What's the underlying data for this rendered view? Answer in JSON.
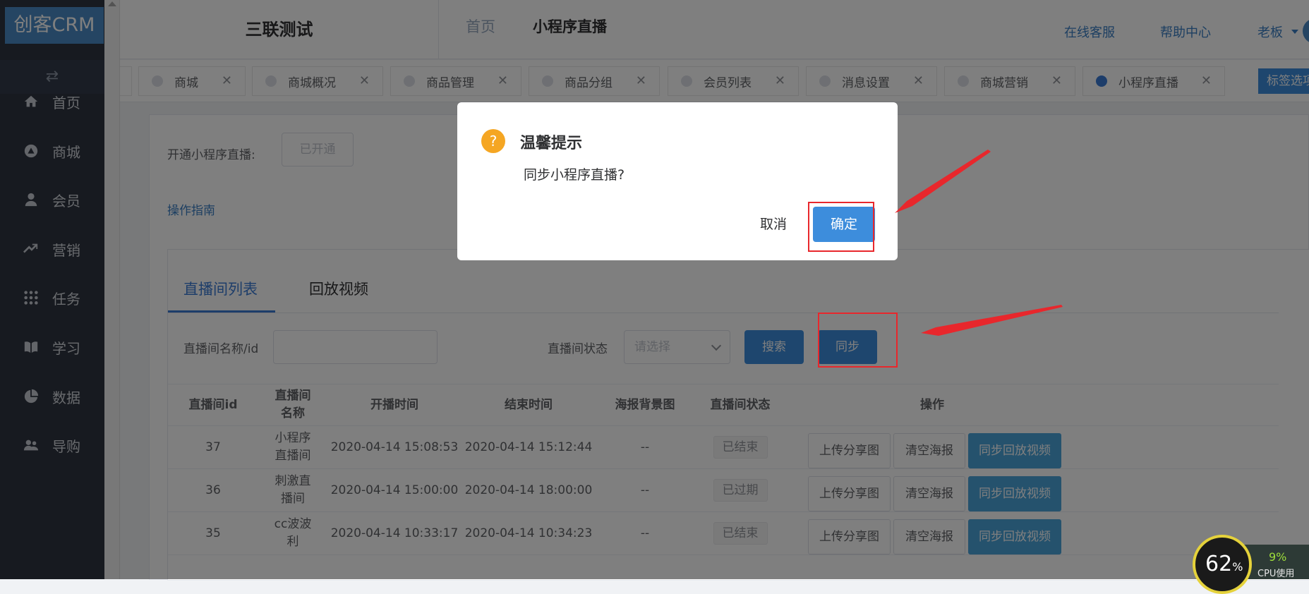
{
  "sidebar": {
    "logo": "创客CRM",
    "collapse_icon": "swap-arrows-icon",
    "items": [
      {
        "label": "首页",
        "icon": "home-icon"
      },
      {
        "label": "商城",
        "icon": "shop-icon"
      },
      {
        "label": "会员",
        "icon": "user-icon"
      },
      {
        "label": "营销",
        "icon": "trend-icon"
      },
      {
        "label": "任务",
        "icon": "grid-icon"
      },
      {
        "label": "学习",
        "icon": "book-icon"
      },
      {
        "label": "数据",
        "icon": "pie-icon"
      },
      {
        "label": "导购",
        "icon": "people-icon"
      }
    ]
  },
  "header": {
    "app_name": "三联测试",
    "breadcrumb_home": "首页",
    "breadcrumb_current": "小程序直播",
    "links": [
      "在线客服",
      "帮助中心"
    ],
    "user": "老板"
  },
  "tabs": {
    "items": [
      {
        "label": "商城",
        "active": false
      },
      {
        "label": "商城概况",
        "active": false
      },
      {
        "label": "商品管理",
        "active": false
      },
      {
        "label": "商品分组",
        "active": false
      },
      {
        "label": "会员列表",
        "active": false
      },
      {
        "label": "消息设置",
        "active": false
      },
      {
        "label": "商城营销",
        "active": false
      },
      {
        "label": "小程序直播",
        "active": true
      }
    ],
    "close_glyph": "✕",
    "options_button": "标签选项"
  },
  "content": {
    "open_label": "开通小程序直播:",
    "open_button": "已开通",
    "guide_link": "操作指南",
    "tabs": [
      "直播间列表",
      "回放视频"
    ],
    "filter": {
      "name_label": "直播间名称/id",
      "name_value": "",
      "status_label": "直播间状态",
      "status_placeholder": "请选择",
      "search_button": "搜索",
      "sync_button": "同步"
    },
    "table": {
      "headers": [
        "直播间id",
        "直播间\n名称",
        "开播时间",
        "结束时间",
        "海报背景图",
        "直播间状态",
        "操作"
      ],
      "rows": [
        {
          "id": "37",
          "name": "小程序\n直播间",
          "start": "2020-04-14 15:08:53",
          "end": "2020-04-14 15:12:44",
          "poster": "--",
          "status": "已结束"
        },
        {
          "id": "36",
          "name": "刺激直\n播间",
          "start": "2020-04-14 15:00:00",
          "end": "2020-04-14 18:00:00",
          "poster": "--",
          "status": "已过期"
        },
        {
          "id": "35",
          "name": "cc波波\n利",
          "start": "2020-04-14 10:33:17",
          "end": "2020-04-14 10:34:23",
          "poster": "--",
          "status": "已结束"
        }
      ],
      "actions": [
        "上传分享图",
        "清空海报",
        "同步回放视频"
      ]
    }
  },
  "dialog": {
    "icon_text": "?",
    "title": "温馨提示",
    "message": "同步小程序直播?",
    "cancel": "取消",
    "confirm": "确定"
  },
  "colors": {
    "sidebar_bg": "#2f3440",
    "primary": "#3d8ddc",
    "highlight": "#e8272c",
    "warning": "#f5a623"
  },
  "cpu_widget": {
    "percent": "62",
    "percent_sign": "%",
    "secondary": "9%",
    "label": "CPU使用"
  }
}
